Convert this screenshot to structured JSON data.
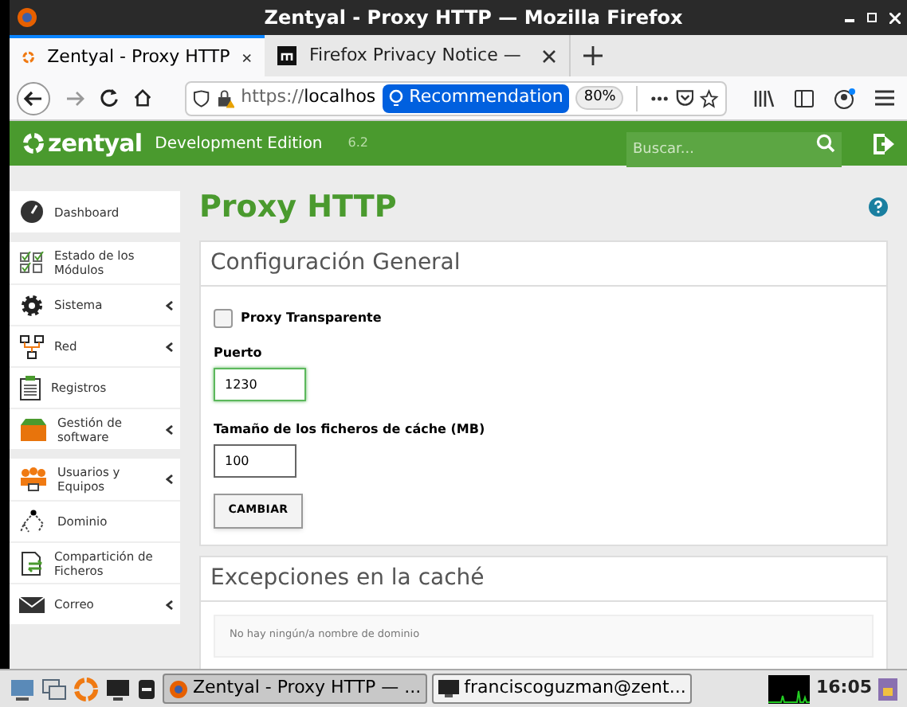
{
  "window": {
    "title": "Zentyal - Proxy HTTP — Mozilla Firefox"
  },
  "tabs": [
    {
      "label": "Zentyal - Proxy HTTP",
      "selected": true
    },
    {
      "label": "Firefox Privacy Notice —",
      "selected": false
    }
  ],
  "address_bar": {
    "url_prefix": "https://",
    "url_host": "localhos",
    "recommendation": "Recommendation",
    "zoom": "80%"
  },
  "header": {
    "brand": "zentyal",
    "edition": "Development Edition",
    "version": "6.2",
    "search": {
      "placeholder": "Buscar..."
    }
  },
  "sidebar": {
    "groups": [
      [
        {
          "label": "Dashboard",
          "submenu": false
        }
      ],
      [
        {
          "label": "Estado de los Módulos",
          "submenu": false
        },
        {
          "label": "Sistema",
          "submenu": true
        },
        {
          "label": "Red",
          "submenu": true
        },
        {
          "label": "Registros",
          "submenu": false
        },
        {
          "label": "Gestión de software",
          "submenu": true
        }
      ],
      [
        {
          "label": "Usuarios y Equipos",
          "submenu": true
        },
        {
          "label": "Dominio",
          "submenu": false
        },
        {
          "label": "Compartición de Ficheros",
          "submenu": false
        },
        {
          "label": "Correo",
          "submenu": true
        }
      ]
    ]
  },
  "page": {
    "title": "Proxy HTTP",
    "general": {
      "title": "Configuración General",
      "transparent": {
        "label": "Proxy Transparente",
        "checked": false
      },
      "port": {
        "label": "Puerto",
        "value": "1230",
        "focused": true
      },
      "cache_size": {
        "label": "Tamaño de los ficheros de cáche (MB)",
        "value": "100",
        "focused": false
      },
      "button": "CAMBIAR"
    },
    "exceptions": {
      "title": "Excepciones en la caché",
      "empty": "No hay ningún/a nombre de dominio"
    }
  },
  "taskbar": {
    "windows": [
      {
        "label": "Zentyal - Proxy HTTP — ...",
        "selected": true
      },
      {
        "label": "franciscoguzman@zent...",
        "selected": false
      }
    ],
    "clock": "16:05"
  }
}
